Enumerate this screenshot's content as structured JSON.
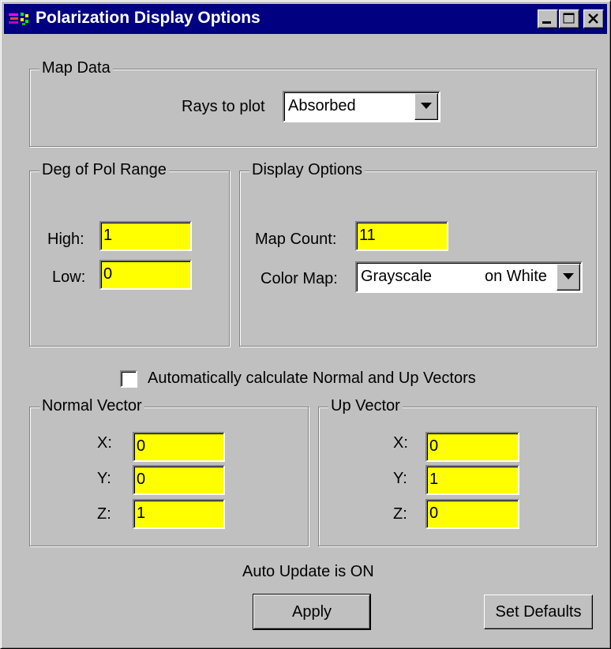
{
  "window": {
    "title": "Polarization Display Options",
    "controls": [
      "minimize-icon",
      "maximize-icon",
      "close-icon"
    ]
  },
  "map_data": {
    "legend": "Map Data",
    "rays_label": "Rays to plot",
    "rays_value": "Absorbed"
  },
  "deg_of_pol": {
    "legend": "Deg of Pol Range",
    "high_label": "High:",
    "high_value": "1",
    "low_label": "Low:",
    "low_value": "0"
  },
  "display_options": {
    "legend": "Display Options",
    "map_count_label": "Map Count:",
    "map_count_value": "11",
    "color_map_label": "Color Map:",
    "color_map_value_left": "Grayscale",
    "color_map_value_right": "on White"
  },
  "auto_calc": {
    "label": "Automatically calculate Normal and Up Vectors",
    "checked": false
  },
  "normal_vector": {
    "legend": "Normal Vector",
    "x_label": "X:",
    "x_value": "0",
    "y_label": "Y:",
    "y_value": "0",
    "z_label": "Z:",
    "z_value": "1"
  },
  "up_vector": {
    "legend": "Up Vector",
    "x_label": "X:",
    "x_value": "0",
    "y_label": "Y:",
    "y_value": "1",
    "z_label": "Z:",
    "z_value": "0"
  },
  "status": {
    "auto_update": "Auto Update is ON"
  },
  "buttons": {
    "apply": "Apply",
    "set_defaults": "Set Defaults"
  },
  "colors": {
    "field_bg": "#ffff00",
    "face": "#c0c0c0",
    "titlebar": "#000080"
  }
}
